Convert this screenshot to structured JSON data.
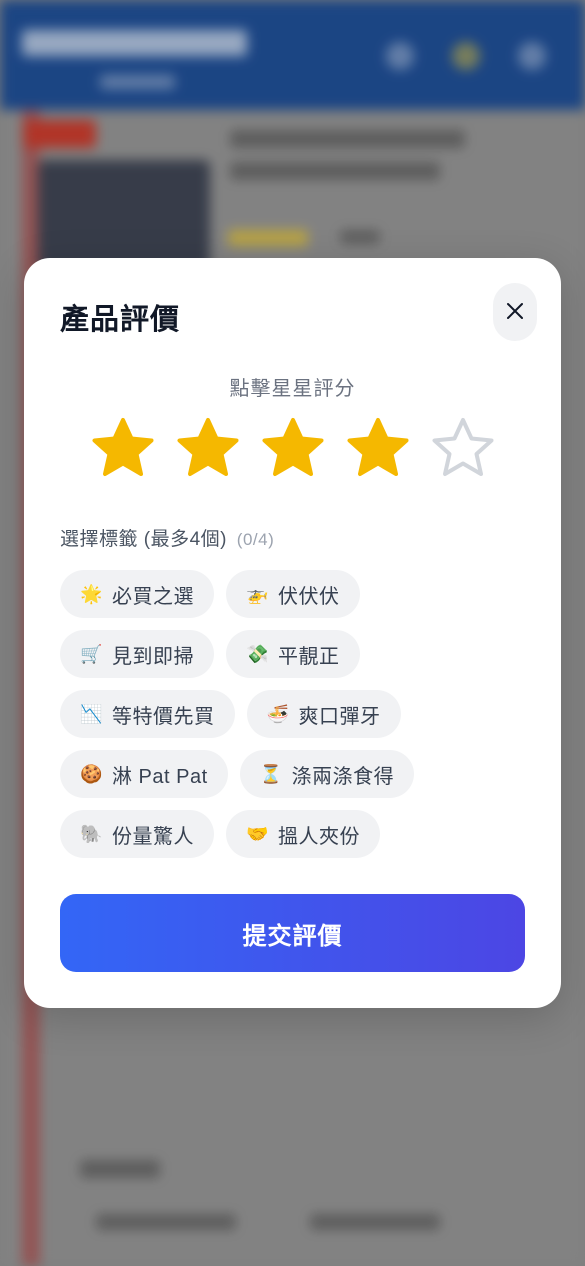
{
  "modal": {
    "title": "產品評價",
    "close_icon": "close-icon",
    "rating_prompt": "點擊星星評分",
    "rating": {
      "value": 4,
      "max": 5,
      "filled_color": "#f5b800",
      "empty_color": "#d1d5db"
    },
    "tags_label": "選擇標籤 (最多4個)",
    "tags_count": "(0/4)",
    "tags": [
      {
        "icon": "sun-icon",
        "emoji": "🌟",
        "label": "必買之選"
      },
      {
        "icon": "helicopter-icon",
        "emoji": "🚁",
        "label": "伏伏伏"
      },
      {
        "icon": "shopping-cart-icon",
        "emoji": "🛒",
        "label": "見到即掃"
      },
      {
        "icon": "money-icon",
        "emoji": "💸",
        "label": "平靚正"
      },
      {
        "icon": "chart-down-icon",
        "emoji": "📉",
        "label": "等特價先買"
      },
      {
        "icon": "noodle-bowl-icon",
        "emoji": "🍜",
        "label": "爽口彈牙"
      },
      {
        "icon": "cookie-icon",
        "emoji": "🍪",
        "label": "淋 Pat Pat"
      },
      {
        "icon": "hourglass-icon",
        "emoji": "⏳",
        "label": "涤兩涤食得"
      },
      {
        "icon": "elephant-icon",
        "emoji": "🐘",
        "label": "份量驚人"
      },
      {
        "icon": "handshake-icon",
        "emoji": "🤝",
        "label": "搵人夾份"
      }
    ],
    "submit_label": "提交評價",
    "submit_gradient": [
      "#3366f6",
      "#4c46e4"
    ]
  },
  "background": {
    "header_color": "#1e4b8f"
  }
}
